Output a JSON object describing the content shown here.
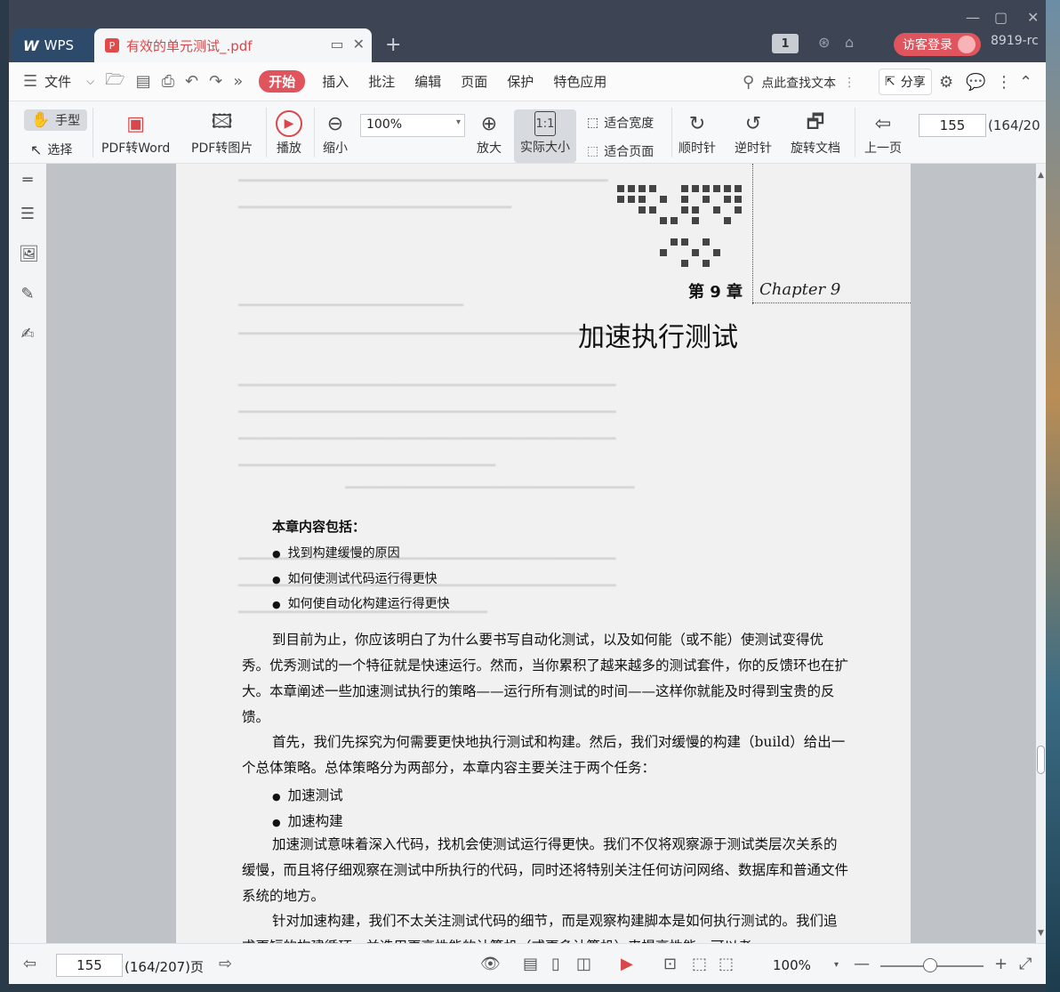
{
  "titlebar": {
    "wps_tab": "WPS",
    "doc_tab": "有效的单元测试_.pdf",
    "page_badge": "1",
    "login": "访客登录",
    "user_id": "8919-rc"
  },
  "menubar": {
    "file": "文件",
    "items": [
      "开始",
      "插入",
      "批注",
      "编辑",
      "页面",
      "保护",
      "特色应用"
    ],
    "find": "点此查找文本",
    "share": "分享"
  },
  "toolbar": {
    "hand": "手型",
    "select": "选择",
    "pdf_to_word": "PDF转Word",
    "pdf_to_image": "PDF转图片",
    "play": "播放",
    "zoom_out": "缩小",
    "zoom_value": "100%",
    "zoom_in": "放大",
    "actual_size": "实际大小",
    "fit_width": "适合宽度",
    "fit_page": "适合页面",
    "clockwise": "顺时针",
    "counter_clockwise": "逆时针",
    "rotate_doc": "旋转文档",
    "prev_page": "上一页",
    "page_value": "155",
    "page_count": "(164/20"
  },
  "document": {
    "chapter_num": "第 9 章",
    "chapter_en": "Chapter 9",
    "chapter_title": "加速执行测试",
    "contents_head": "本章内容包括：",
    "contents": [
      "找到构建缓慢的原因",
      "如何使测试代码运行得更快",
      "如何使自动化构建运行得更快"
    ],
    "para1": "到目前为止，你应该明白了为什么要书写自动化测试，以及如何能（或不能）使测试变得优秀。优秀测试的一个特征就是快速运行。然而，当你累积了越来越多的测试套件，你的反馈环也在扩大。本章阐述一些加速测试执行的策略——运行所有测试的时间——这样你就能及时得到宝贵的反馈。",
    "para2": "首先，我们先探究为何需要更快地执行测试和构建。然后，我们对缓慢的构建（build）给出一个总体策略。总体策略分为两部分，本章内容主要关注于两个任务：",
    "tasks": [
      "加速测试",
      "加速构建"
    ],
    "para3": "加速测试意味着深入代码，找机会使测试运行得更快。我们不仅将观察源于测试类层次关系的缓慢，而且将仔细观察在测试中所执行的代码，同时还将特别关注任何访问网络、数据库和普通文件系统的地方。",
    "para4": "针对加速构建，我们不太关注测试代码的细节，而是观察构建脚本是如何执行测试的。我们追求更短的构建循环，并选用更高性能的计算机（或更多计算机）来提高性能，可以考"
  },
  "statusbar": {
    "page_value": "155",
    "page_count": "(164/207)页",
    "zoom": "100%"
  }
}
